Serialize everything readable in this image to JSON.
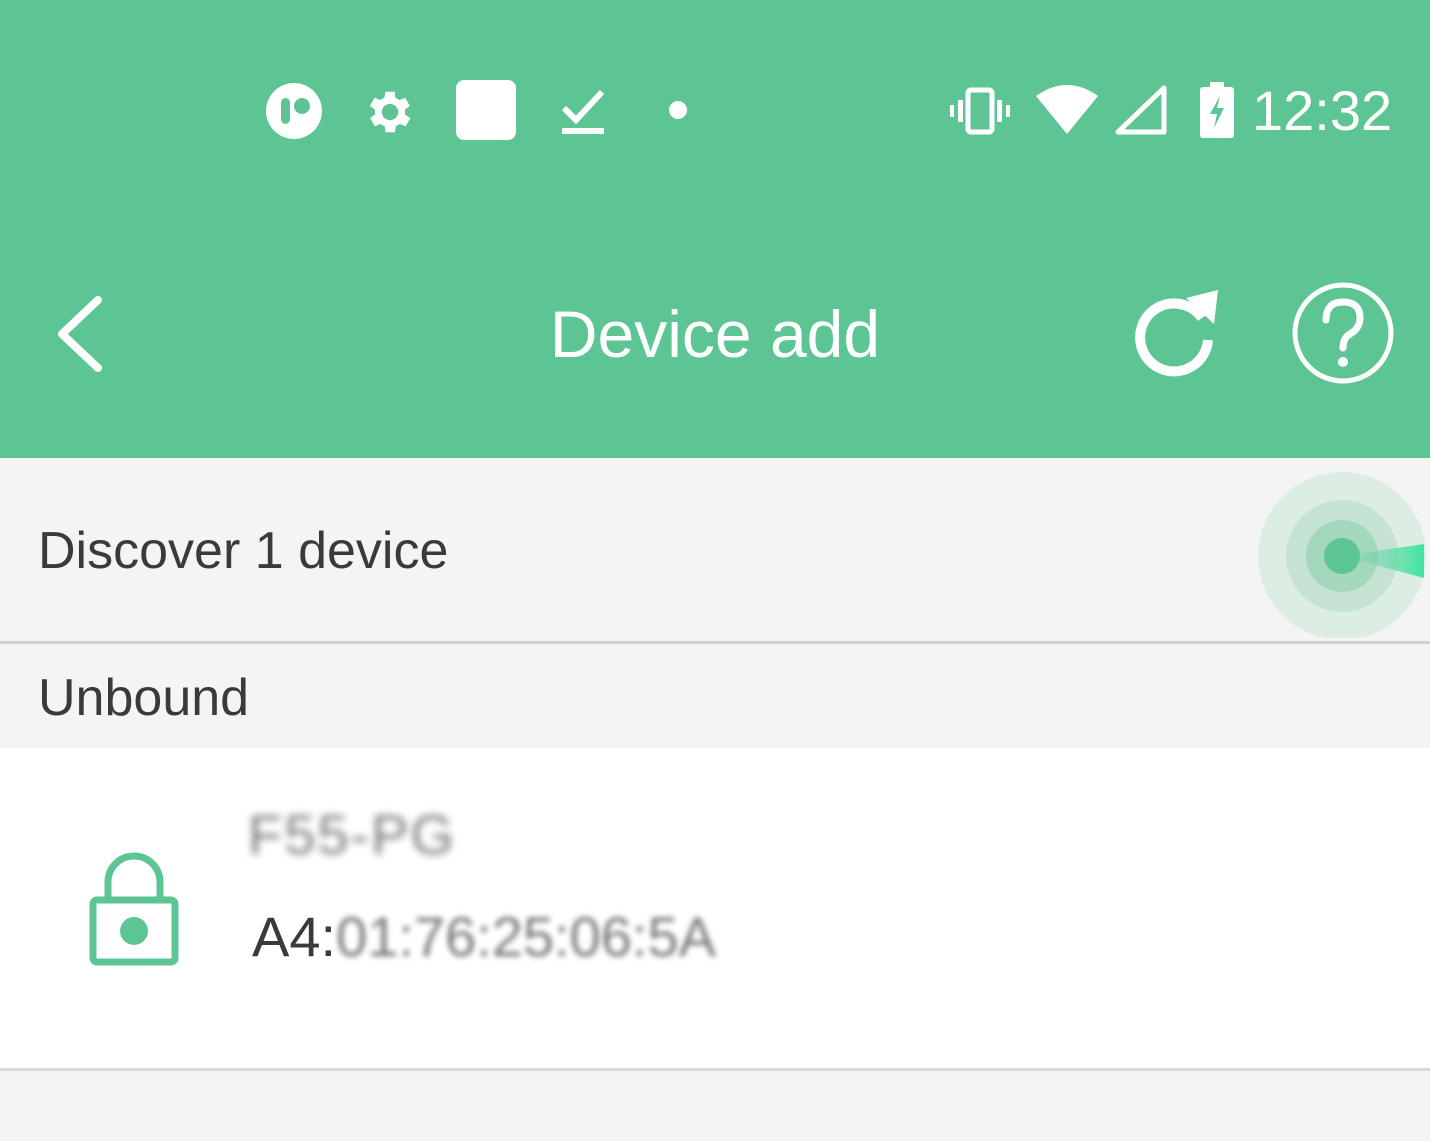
{
  "status_bar": {
    "time": "12:32",
    "left_icons": [
      "app-notification-icon",
      "settings-icon",
      "square-notification-icon",
      "download-done-icon",
      "dot-icon"
    ],
    "right_icons": [
      "vibrate-icon",
      "wifi-icon",
      "cell-signal-icon",
      "battery-charging-icon"
    ]
  },
  "app_bar": {
    "title": "Device add",
    "back_icon": "chevron-left-icon",
    "refresh_icon": "refresh-icon",
    "help_icon": "help-icon"
  },
  "discover": {
    "text": "Discover 1 device",
    "scan_icon": "radar-scan-icon"
  },
  "section": {
    "label": "Unbound"
  },
  "devices": [
    {
      "name": "F55-PG",
      "mac_prefix": "A4:",
      "mac_rest": "01:76:25:06:5A",
      "icon": "lock-icon"
    }
  ],
  "colors": {
    "primary": "#5dc594",
    "text_dark": "#3a3a3a",
    "background": "#f4f4f4",
    "divider": "#d2d2d2"
  }
}
